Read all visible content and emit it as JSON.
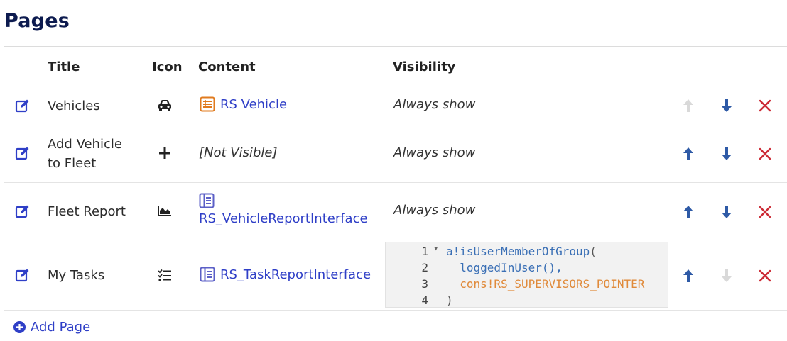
{
  "page_title": "Pages",
  "columns": {
    "title": "Title",
    "icon": "Icon",
    "content": "Content",
    "visibility": "Visibility"
  },
  "rows": [
    {
      "title": "Vehicles",
      "icon": "car-icon",
      "content": "RS Vehicle",
      "content_icon": "record-type-icon",
      "visibility": "Always show",
      "move_up_enabled": false,
      "move_down_enabled": true
    },
    {
      "title_line1": "Add Vehicle",
      "title_line2": "to Fleet",
      "icon": "plus-icon",
      "content": "[Not Visible]",
      "visibility": "Always show",
      "move_up_enabled": true,
      "move_down_enabled": true
    },
    {
      "title": "Fleet Report",
      "icon": "area-chart-icon",
      "content": "RS_VehicleReportInterface",
      "content_icon": "interface-icon",
      "visibility": "Always show",
      "move_up_enabled": true,
      "move_down_enabled": true
    },
    {
      "title": "My Tasks",
      "icon": "task-list-icon",
      "content": "RS_TaskReportInterface",
      "content_icon": "interface-icon",
      "visibility_code": {
        "lines": [
          {
            "num": "1",
            "text_fn": "a!isUserMemberOfGroup",
            "text_punc": "("
          },
          {
            "num": "2",
            "text": "  loggedInUser(),"
          },
          {
            "num": "3",
            "text_const": "  cons!RS_SUPERVISORS_POINTER"
          },
          {
            "num": "4",
            "text_punc": ")"
          }
        ]
      },
      "move_up_enabled": true,
      "move_down_enabled": false
    }
  ],
  "add_page_label": "Add Page",
  "colors": {
    "title": "#0d1b4f",
    "link": "#2f3fc7",
    "arrow": "#2e5aa6",
    "arrow_disabled": "#d9d9d9",
    "delete": "#cc2b36",
    "record_icon": "#e07b1f",
    "interface_icon": "#5b5fc7"
  }
}
